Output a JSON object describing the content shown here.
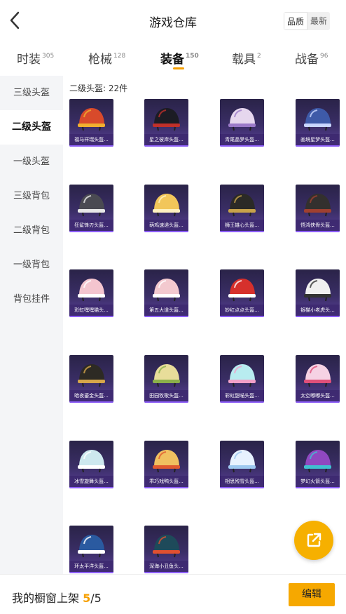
{
  "header": {
    "title": "游戏仓库",
    "sort_quality": "品质",
    "sort_latest": "最新"
  },
  "tabs": [
    {
      "label": "时装",
      "count": "305"
    },
    {
      "label": "枪械",
      "count": "128"
    },
    {
      "label": "装备",
      "count": "150"
    },
    {
      "label": "载具",
      "count": "2"
    },
    {
      "label": "战备",
      "count": "96"
    }
  ],
  "sidebar": {
    "items": [
      "三级头盔",
      "二级头盔",
      "一级头盔",
      "三级背包",
      "二级背包",
      "一级背包",
      "背包挂件"
    ]
  },
  "main": {
    "subtitle": "二级头盔: 22件",
    "items": [
      {
        "name": "福马祥瑞头盔...",
        "icon": "red-helmet-icon",
        "color": "#d84a2b",
        "trim": "#f0b030"
      },
      {
        "name": "星之彼岸头盔...",
        "icon": "black-helmet-icon",
        "color": "#1c1c24",
        "trim": "#c0302a"
      },
      {
        "name": "青尾晶梦头盔...",
        "icon": "pink-helmet-icon",
        "color": "#e6d7ee",
        "trim": "#9b7ac8"
      },
      {
        "name": "画境星梦头盔...",
        "icon": "blue-helmet-icon",
        "color": "#3e5aa8",
        "trim": "#c9d6ff"
      },
      {
        "name": "狂鲨锋刃头盔...",
        "icon": "shark-helmet-icon",
        "color": "#4a4a52",
        "trim": "#e8e8e8"
      },
      {
        "name": "萌鸡速递头盔...",
        "icon": "chick-helmet-icon",
        "color": "#f2c65a",
        "trim": "#fff2c0"
      },
      {
        "name": "狮王雄心头盔...",
        "icon": "lion-helmet-icon",
        "color": "#2b2a26",
        "trim": "#c8a34a"
      },
      {
        "name": "悟鸿侠骨头盔...",
        "icon": "dark-helmet-icon",
        "color": "#33302e",
        "trim": "#a04030"
      },
      {
        "name": "彩虹嘿嘿猫头...",
        "icon": "pink-cat-helmet-icon",
        "color": "#f4c5cf",
        "trim": "#ffffff"
      },
      {
        "name": "第五大道头盔...",
        "icon": "floral-helmet-icon",
        "color": "#f3c9cf",
        "trim": "#ffffff"
      },
      {
        "name": "妙红点点头盔...",
        "icon": "red-dot-helmet-icon",
        "color": "#d6302c",
        "trim": "#ffffff"
      },
      {
        "name": "银猫小老虎头...",
        "icon": "tiger-helmet-icon",
        "color": "#f0f0f0",
        "trim": "#333333"
      },
      {
        "name": "暗夜鎏金头盔...",
        "icon": "gold-helmet-icon",
        "color": "#2d2a24",
        "trim": "#d6a64a"
      },
      {
        "name": "田园牧歌头盔...",
        "icon": "leaf-helmet-icon",
        "color": "#e8dd9a",
        "trim": "#8bb04a"
      },
      {
        "name": "彩虹甜喵头盔...",
        "icon": "cat-ear-helmet-icon",
        "color": "#b8ecf0",
        "trim": "#f2a0c8"
      },
      {
        "name": "太空嘟嘟头盔...",
        "icon": "space-helmet-icon",
        "color": "#f6d2e4",
        "trim": "#e0507a"
      },
      {
        "name": "冰雪旋舞头盔...",
        "icon": "ice-helmet-icon",
        "color": "#cde8ee",
        "trim": "#ffffff"
      },
      {
        "name": "乖巧戏鸭头盔...",
        "icon": "duck-helmet-icon",
        "color": "#f0c060",
        "trim": "#e05a30"
      },
      {
        "name": "相思残雪头盔...",
        "icon": "snow-helmet-icon",
        "color": "#e8f2ff",
        "trim": "#9ec8f0"
      },
      {
        "name": "梦幻火箭头盔...",
        "icon": "rocket-helmet-icon",
        "color": "#9048c0",
        "trim": "#40c0d0"
      },
      {
        "name": "环太平洋头盔...",
        "icon": "ocean-helmet-icon",
        "color": "#2a5aa0",
        "trim": "#ffffff"
      },
      {
        "name": "深海小丑鱼头...",
        "icon": "clownfish-helmet-icon",
        "color": "#1e4a5a",
        "trim": "#e05030"
      }
    ]
  },
  "footer": {
    "label": "我的橱窗上架",
    "current": "5",
    "separator": "/",
    "total": "5",
    "edit": "编辑"
  },
  "colors": {
    "accent": "#f6a800",
    "card_bg": "#3a2e66"
  }
}
